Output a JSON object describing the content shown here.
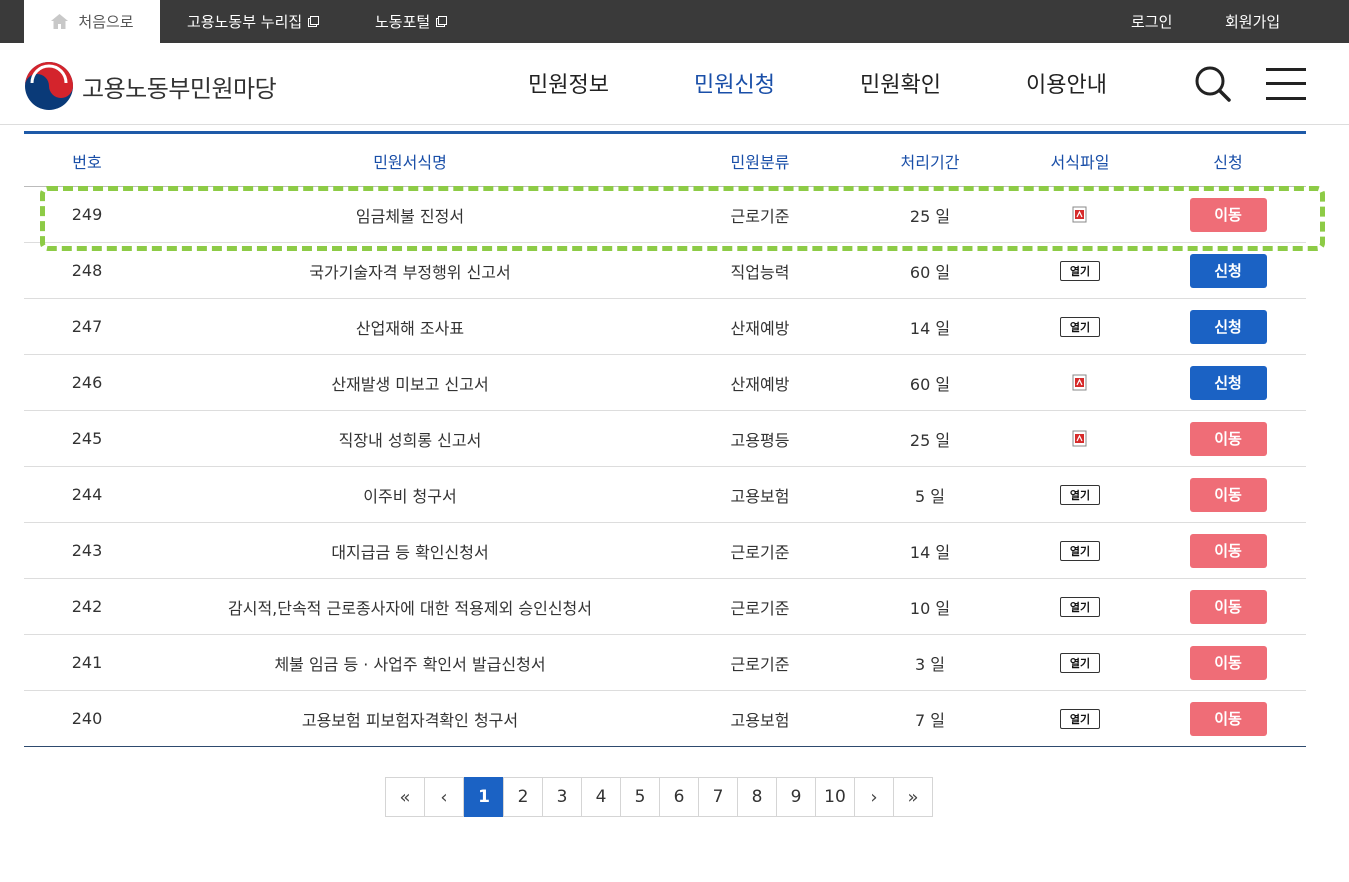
{
  "topbar": {
    "home_label": "처음으로",
    "links": [
      "고용노동부 누리집",
      "노동포털"
    ],
    "login": "로그인",
    "signup": "회원가입"
  },
  "header": {
    "logo_text": "고용노동부민원마당",
    "nav": [
      "민원정보",
      "민원신청",
      "민원확인",
      "이용안내"
    ],
    "active_nav": "민원신청"
  },
  "table": {
    "headers": [
      "번호",
      "민원서식명",
      "민원분류",
      "처리기간",
      "서식파일",
      "신청"
    ],
    "rows": [
      {
        "no": "249",
        "name": "임금체불 진정서",
        "category": "근로기준",
        "period": "25 일",
        "file": "pdf-icon",
        "action": "이동",
        "action_type": "move"
      },
      {
        "no": "248",
        "name": "국가기술자격 부정행위 신고서",
        "category": "직업능력",
        "period": "60 일",
        "file": "열기",
        "action": "신청",
        "action_type": "apply"
      },
      {
        "no": "247",
        "name": "산업재해 조사표",
        "category": "산재예방",
        "period": "14 일",
        "file": "열기",
        "action": "신청",
        "action_type": "apply"
      },
      {
        "no": "246",
        "name": "산재발생 미보고 신고서",
        "category": "산재예방",
        "period": "60 일",
        "file": "pdf-icon",
        "action": "신청",
        "action_type": "apply"
      },
      {
        "no": "245",
        "name": "직장내 성희롱 신고서",
        "category": "고용평등",
        "period": "25 일",
        "file": "pdf-icon",
        "action": "이동",
        "action_type": "move"
      },
      {
        "no": "244",
        "name": "이주비 청구서",
        "category": "고용보험",
        "period": "5 일",
        "file": "열기",
        "action": "이동",
        "action_type": "move"
      },
      {
        "no": "243",
        "name": "대지급금 등 확인신청서",
        "category": "근로기준",
        "period": "14 일",
        "file": "열기",
        "action": "이동",
        "action_type": "move"
      },
      {
        "no": "242",
        "name": "감시적,단속적 근로종사자에 대한 적용제외 승인신청서",
        "category": "근로기준",
        "period": "10 일",
        "file": "열기",
        "action": "이동",
        "action_type": "move"
      },
      {
        "no": "241",
        "name": "체불 임금 등 · 사업주 확인서 발급신청서",
        "category": "근로기준",
        "period": "3 일",
        "file": "열기",
        "action": "이동",
        "action_type": "move"
      },
      {
        "no": "240",
        "name": "고용보험 피보험자격확인 청구서",
        "category": "고용보험",
        "period": "7 일",
        "file": "열기",
        "action": "이동",
        "action_type": "move"
      }
    ]
  },
  "pagination": {
    "first": "«",
    "prev": "‹",
    "pages": [
      "1",
      "2",
      "3",
      "4",
      "5",
      "6",
      "7",
      "8",
      "9",
      "10"
    ],
    "current": "1",
    "next": "›",
    "last": "»"
  },
  "colors": {
    "accent": "#1b62c4",
    "move_button": "#ef6d77",
    "highlight": "#8dcb46",
    "topbar": "#3a3a3a"
  }
}
